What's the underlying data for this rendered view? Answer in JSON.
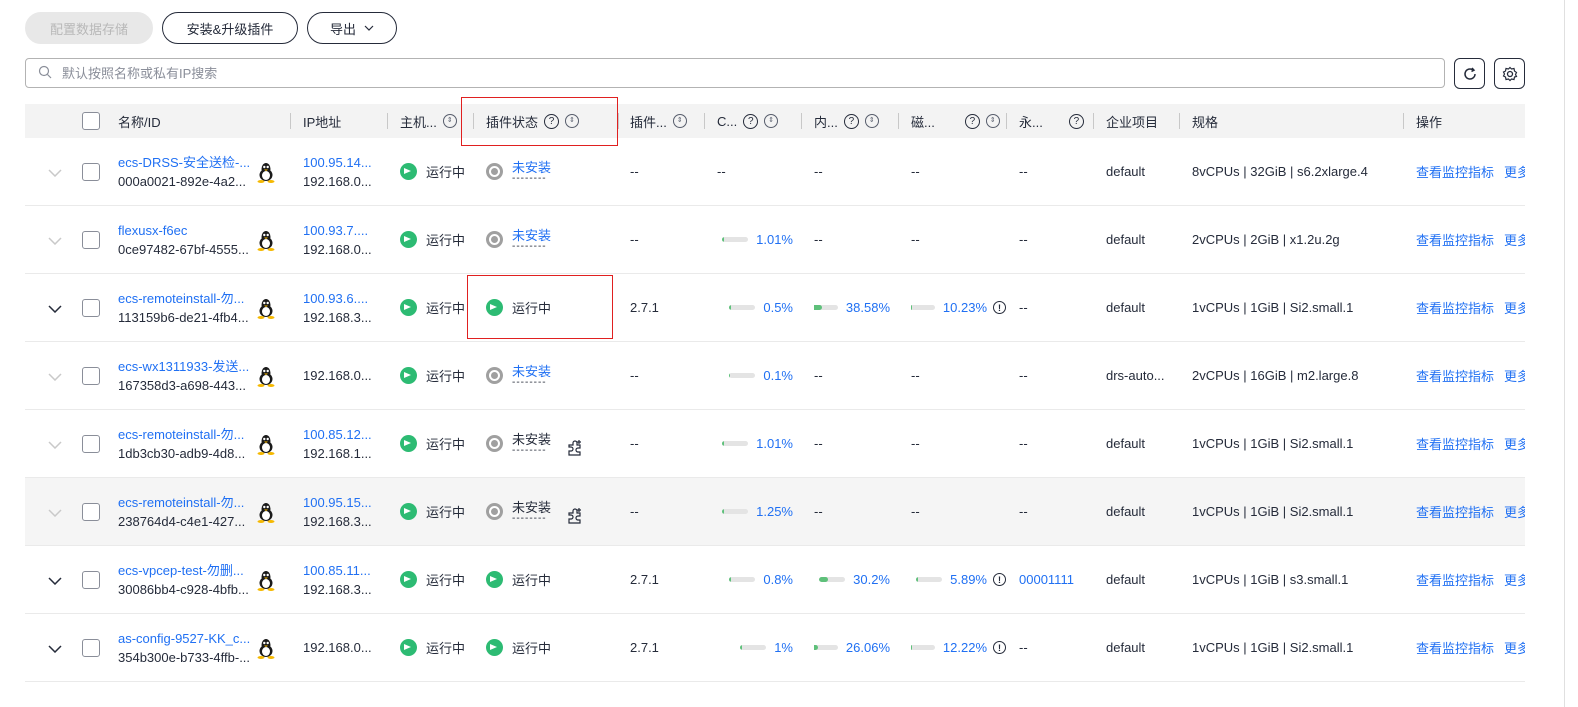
{
  "toolbar": {
    "config_storage": "配置数据存储",
    "install_upgrade": "安装&升级插件",
    "export": "导出"
  },
  "search": {
    "placeholder": "默认按照名称或私有IP搜索"
  },
  "columns": {
    "name": "名称/ID",
    "ip": "IP地址",
    "host": "主机...",
    "plugin_status": "插件状态",
    "plugin_ver": "插件...",
    "cpu": "C...",
    "mem": "内...",
    "disk": "磁...",
    "perm": "永...",
    "enterprise": "企业项目",
    "spec": "规格",
    "action": "操作"
  },
  "status_running": "运行中",
  "not_installed": "未安装",
  "dashes": "--------",
  "action_link": "查看监控指标",
  "action_more": "更多",
  "colors": {
    "accent": "#2070f3",
    "running": "#2dbb73",
    "highlight": "#e02020"
  },
  "rows": [
    {
      "expand": false,
      "name": "ecs-DRSS-安全送检-...",
      "id": "000a0021-892e-4a2...",
      "ip1": "100.95.14...",
      "ip2": "192.168.0...",
      "plugin": "notinstalled_link",
      "ver": "--",
      "cpu": "--",
      "mem": "--",
      "disk": "--",
      "perm": "--",
      "enterprise": "default",
      "spec": "8vCPUs | 32GiB | s6.2xlarge.4"
    },
    {
      "expand": false,
      "name": "flexusx-f6ec",
      "id": "0ce97482-67bf-4555...",
      "ip1": "100.93.7....",
      "ip2": "192.168.0...",
      "plugin": "notinstalled_link",
      "ver": "--",
      "cpu": "1.01%",
      "mem": "--",
      "disk": "--",
      "perm": "--",
      "enterprise": "default",
      "spec": "2vCPUs | 2GiB | x1.2u.2g"
    },
    {
      "expand": true,
      "name": "ecs-remoteinstall-勿...",
      "id": "113159b6-de21-4fb4...",
      "ip1": "100.93.6....",
      "ip2": "192.168.3...",
      "plugin": "running",
      "ver": "2.7.1",
      "cpu": "0.5%",
      "mem": "38.58%",
      "disk": "10.23%",
      "perm": "--",
      "enterprise": "default",
      "spec": "1vCPUs | 1GiB | Si2.small.1"
    },
    {
      "expand": false,
      "name": "ecs-wx1311933-发送...",
      "id": "167358d3-a698-443...",
      "ip1": "",
      "ip2": "192.168.0...",
      "plugin": "notinstalled_link",
      "ver": "--",
      "cpu": "0.1%",
      "mem": "--",
      "disk": "--",
      "perm": "--",
      "enterprise": "drs-auto...",
      "spec": "2vCPUs | 16GiB | m2.large.8"
    },
    {
      "expand": false,
      "name": "ecs-remoteinstall-勿...",
      "id": "1db3cb30-adb9-4d8...",
      "ip1": "100.85.12...",
      "ip2": "192.168.1...",
      "plugin": "notinstalled_plain",
      "ver": "--",
      "cpu": "1.01%",
      "mem": "--",
      "disk": "--",
      "perm": "--",
      "enterprise": "default",
      "spec": "1vCPUs | 1GiB | Si2.small.1"
    },
    {
      "expand": false,
      "name": "ecs-remoteinstall-勿...",
      "id": "238764d4-c4e1-427...",
      "ip1": "100.95.15...",
      "ip2": "192.168.3...",
      "plugin": "notinstalled_plain",
      "ver": "--",
      "cpu": "1.25%",
      "mem": "--",
      "disk": "--",
      "perm": "--",
      "enterprise": "default",
      "spec": "1vCPUs | 1GiB | Si2.small.1"
    },
    {
      "expand": true,
      "name": "ecs-vpcep-test-勿删...",
      "id": "30086bb4-c928-4bfb...",
      "ip1": "100.85.11...",
      "ip2": "192.168.3...",
      "plugin": "running",
      "ver": "2.7.1",
      "cpu": "0.8%",
      "mem": "30.2%",
      "disk": "5.89%",
      "perm": "00001111",
      "enterprise": "default",
      "spec": "1vCPUs | 1GiB | s3.small.1"
    },
    {
      "expand": true,
      "name": "as-config-9527-KK_c...",
      "id": "354b300e-b733-4ffb-...",
      "ip1": "",
      "ip2": "192.168.0...",
      "plugin": "running",
      "ver": "2.7.1",
      "cpu": "1%",
      "mem": "26.06%",
      "disk": "12.22%",
      "perm": "--",
      "enterprise": "default",
      "spec": "1vCPUs | 1GiB | Si2.small.1"
    }
  ]
}
